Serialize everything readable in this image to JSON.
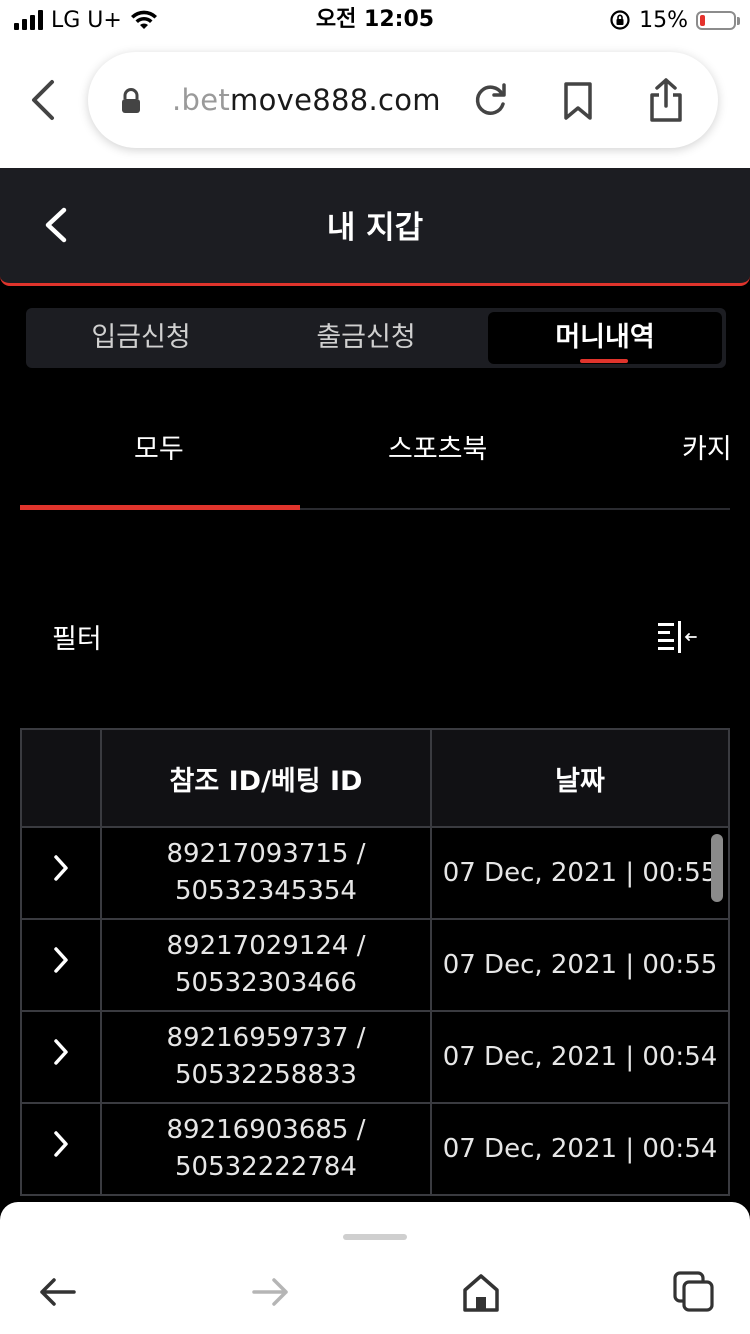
{
  "status_bar": {
    "carrier": "LG U+",
    "time": "오전 12:05",
    "battery": "15%",
    "battery_level": 0.15
  },
  "browser": {
    "url_faded": ".bet",
    "url_main": "move888.com"
  },
  "header": {
    "title": "내 지갑"
  },
  "segments": [
    {
      "label": "입금신청",
      "active": false
    },
    {
      "label": "출금신청",
      "active": false
    },
    {
      "label": "머니내역",
      "active": true
    }
  ],
  "subtabs": [
    {
      "label": "모두",
      "active": true
    },
    {
      "label": "스포츠북",
      "active": false
    },
    {
      "label": "카지",
      "active": false
    }
  ],
  "filter": {
    "label": "필터"
  },
  "table": {
    "columns": [
      "",
      "참조 ID/베팅 ID",
      "날짜"
    ],
    "rows": [
      {
        "ref_id": "89217093715 /",
        "bet_id": "50532345354",
        "date": "07 Dec, 2021 | 00:55"
      },
      {
        "ref_id": "89217029124 /",
        "bet_id": "50532303466",
        "date": "07 Dec, 2021 | 00:55"
      },
      {
        "ref_id": "89216959737 /",
        "bet_id": "50532258833",
        "date": "07 Dec, 2021 | 00:54"
      },
      {
        "ref_id": "89216903685 /",
        "bet_id": "50532222784",
        "date": "07 Dec, 2021 | 00:54"
      }
    ]
  },
  "colors": {
    "accent": "#e0342c",
    "header_bg": "#1c1d22",
    "page_bg": "#000000"
  }
}
